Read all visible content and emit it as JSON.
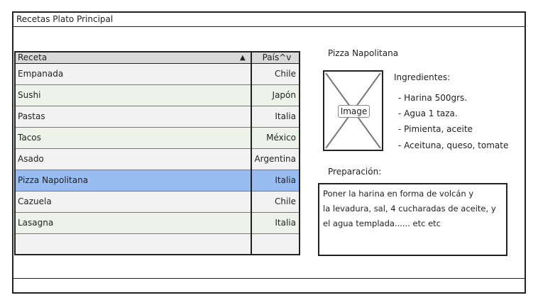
{
  "window": {
    "title": "Recetas Plato Principal"
  },
  "table": {
    "columns": {
      "receta": "Receta",
      "sort_indicator": "▲",
      "pais": "País^v"
    },
    "rows": [
      {
        "receta": "Empanada",
        "pais": "Chile"
      },
      {
        "receta": "Sushi",
        "pais": "Japón"
      },
      {
        "receta": "Pastas",
        "pais": "Italia"
      },
      {
        "receta": "Tacos",
        "pais": "México"
      },
      {
        "receta": "Asado",
        "pais": "Argentina"
      },
      {
        "receta": "Pizza Napolitana",
        "pais": "Italia"
      },
      {
        "receta": "Cazuela",
        "pais": "Chile"
      },
      {
        "receta": "Lasagna",
        "pais": "Italia"
      }
    ],
    "selected_row": "Pizza Napolitana"
  },
  "detail": {
    "title": "Pizza Napolitana",
    "image_placeholder": "Image",
    "ingredients_title": "Ingredientes:",
    "ingredients": [
      "- Harina 500grs.",
      "- Agua 1 taza.",
      "- Pimienta, aceite",
      "- Aceituna, queso, tomate"
    ],
    "preparation_label": "Preparación:",
    "preparation_lines": [
      "Poner la harina en forma de volcán y",
      "la levadura, sal, 4 cucharadas de aceite, y",
      "el agua templada...... etc etc"
    ]
  },
  "colors": {
    "selected_row": "#99bdf0",
    "header_bg": "#d9d9d9",
    "row_odd": "#f2f2f2",
    "row_even": "#eef3ea"
  }
}
